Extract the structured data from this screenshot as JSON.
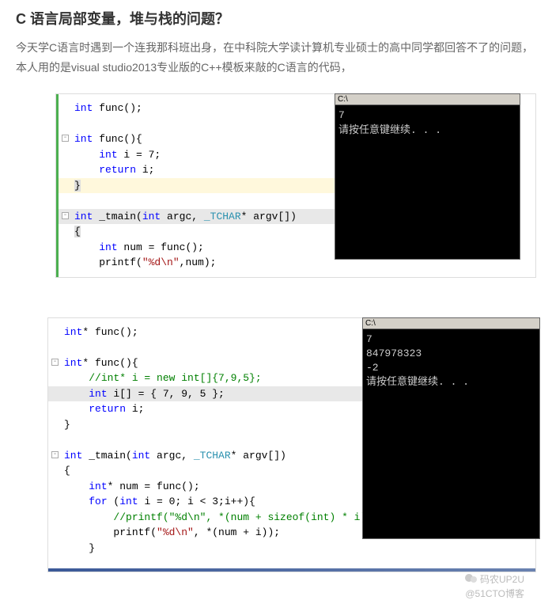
{
  "title": "C 语言局部变量，堆与栈的问题？",
  "description": "今天学C语言时遇到一个连我那科班出身，在中科院大学读计算机专业硕士的高中同学都回答不了的问题，本人用的是visual studio2013专业版的C++模板来敲的C语言的代码，",
  "code1": {
    "l1": "int func();",
    "l2": "int func(){",
    "l3": "    int i = 7;",
    "l4": "    return i;",
    "l5": "}",
    "l6": "int _tmain(int argc, _TCHAR* argv[])",
    "l7": "{",
    "l8": "    int num = func();",
    "l9": "    printf(\"%d\\n\",num);"
  },
  "console1": {
    "titlebar": "C:\\",
    "l1": "7",
    "l2": "请按任意键继续. . ."
  },
  "code2": {
    "l1": "int* func();",
    "l2": "int* func(){",
    "l3": "    //int* i = new int[]{7,9,5};",
    "l4": "    int i[] = { 7, 9, 5 };",
    "l5": "    return i;",
    "l6": "}",
    "l7": "int _tmain(int argc, _TCHAR* argv[])",
    "l8": "{",
    "l9": "    int* num = func();",
    "l10": "    for (int i = 0; i < 3;i++){",
    "l11": "        //printf(\"%d\\n\", *(num + sizeof(int) * i));",
    "l12": "        printf(\"%d\\n\", *(num + i));",
    "l13": "    }"
  },
  "console2": {
    "titlebar": "C:\\",
    "l1": "7",
    "l2": "847978323",
    "l3": "-2",
    "l4": "请按任意键继续. . ."
  },
  "watermark": {
    "name": "码农UP2U",
    "site": "@51CTO博客"
  }
}
